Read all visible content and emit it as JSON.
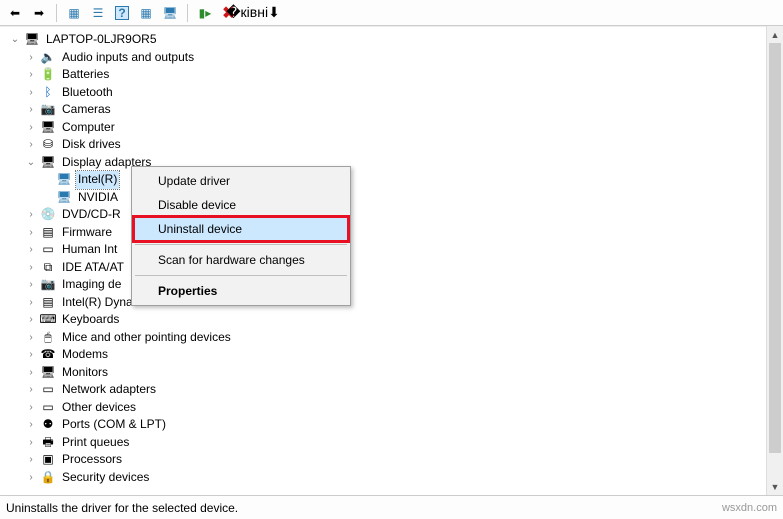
{
  "toolbar": {
    "back": "←",
    "forward": "→",
    "show_hidden": "⧉",
    "properties": "☰",
    "help": "?",
    "refresh": "⧉",
    "scan": "🖥",
    "add": "▮",
    "remove": "✖",
    "uninstall": "⬇"
  },
  "root": {
    "label": "LAPTOP-0LJR9OR5"
  },
  "categories": [
    {
      "label": "Audio inputs and outputs",
      "icon": "🔈",
      "exp": ">"
    },
    {
      "label": "Batteries",
      "icon": "🔋",
      "exp": ">"
    },
    {
      "label": "Bluetooth",
      "icon": "ᛒ",
      "exp": ">",
      "icon_color": "#0a63c2"
    },
    {
      "label": "Cameras",
      "icon": "📷",
      "exp": ">"
    },
    {
      "label": "Computer",
      "icon": "🖥",
      "exp": ">"
    },
    {
      "label": "Disk drives",
      "icon": "⛁",
      "exp": ">"
    },
    {
      "label": "Display adapters",
      "icon": "🖥",
      "exp": "v",
      "children": [
        {
          "label": "Intel(R)",
          "icon": "🖥",
          "selected": true
        },
        {
          "label": "NVIDIA",
          "icon": "🖥"
        }
      ]
    },
    {
      "label": "DVD/CD-R",
      "icon": "💿",
      "exp": ">"
    },
    {
      "label": "Firmware",
      "icon": "▤",
      "exp": ">"
    },
    {
      "label": "Human Int",
      "icon": "▭",
      "exp": ">"
    },
    {
      "label": "IDE ATA/AT",
      "icon": "⧉",
      "exp": ">"
    },
    {
      "label": "Imaging de",
      "icon": "📷",
      "exp": ">"
    },
    {
      "label": "Intel(R) Dynamic Platform and Thermal Framework",
      "icon": "▤",
      "exp": ">"
    },
    {
      "label": "Keyboards",
      "icon": "⌨",
      "exp": ">"
    },
    {
      "label": "Mice and other pointing devices",
      "icon": "🖱",
      "exp": ">"
    },
    {
      "label": "Modems",
      "icon": "☎",
      "exp": ">"
    },
    {
      "label": "Monitors",
      "icon": "🖥",
      "exp": ">"
    },
    {
      "label": "Network adapters",
      "icon": "▭",
      "exp": ">"
    },
    {
      "label": "Other devices",
      "icon": "▭",
      "exp": ">"
    },
    {
      "label": "Ports (COM & LPT)",
      "icon": "⚉",
      "exp": ">"
    },
    {
      "label": "Print queues",
      "icon": "🖶",
      "exp": ">"
    },
    {
      "label": "Processors",
      "icon": "▣",
      "exp": ">"
    },
    {
      "label": "Security devices",
      "icon": "🔒",
      "exp": ">"
    }
  ],
  "context_menu": {
    "update": "Update driver",
    "disable": "Disable device",
    "uninstall": "Uninstall device",
    "scan": "Scan for hardware changes",
    "properties": "Properties"
  },
  "statusbar": {
    "text": "Uninstalls the driver for the selected device."
  },
  "watermark": "wsxdn.com"
}
